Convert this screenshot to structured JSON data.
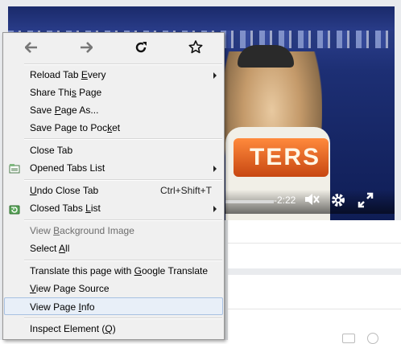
{
  "video": {
    "logo_text": "TERS",
    "time_remaining": "-2:22"
  },
  "nav": {
    "back_icon": "arrow-left-icon",
    "forward_icon": "arrow-right-icon",
    "reload_icon": "reload-icon",
    "bookmark_icon": "star-icon"
  },
  "menu": {
    "reload_tab_every": {
      "pre": "Reload Tab ",
      "key": "E",
      "post": "very"
    },
    "share_this_page": {
      "pre": "Share Thi",
      "key": "s",
      "post": " Page"
    },
    "save_page_as": {
      "pre": "Save ",
      "key": "P",
      "post": "age As..."
    },
    "save_to_pocket": {
      "pre": "Save Page to Poc",
      "key": "k",
      "post": "et"
    },
    "close_tab": {
      "pre": "Close Tab",
      "key": "",
      "post": ""
    },
    "opened_tabs_list": {
      "pre": "Opened Tabs List",
      "key": "",
      "post": ""
    },
    "undo_close_tab": {
      "pre": "",
      "key": "U",
      "post": "ndo Close Tab",
      "shortcut": "Ctrl+Shift+T"
    },
    "closed_tabs_list": {
      "pre": "Closed Tabs ",
      "key": "L",
      "post": "ist"
    },
    "view_background_image": {
      "pre": "View ",
      "key": "B",
      "post": "ackground Image"
    },
    "select_all": {
      "pre": "Select ",
      "key": "A",
      "post": "ll"
    },
    "translate": {
      "pre": "Translate this page with ",
      "key": "G",
      "post": "oogle Translate"
    },
    "view_page_source": {
      "pre": "",
      "key": "V",
      "post": "iew Page Source"
    },
    "view_page_info": {
      "pre": "View Page ",
      "key": "I",
      "post": "nfo"
    },
    "inspect_element": {
      "pre": "Inspect Element (",
      "key": "Q",
      "post": ")"
    }
  },
  "colors": {
    "menu_bg": "#f0f0f0",
    "highlight_bg": "#e8eff8",
    "highlight_border": "#a8c1e2"
  }
}
